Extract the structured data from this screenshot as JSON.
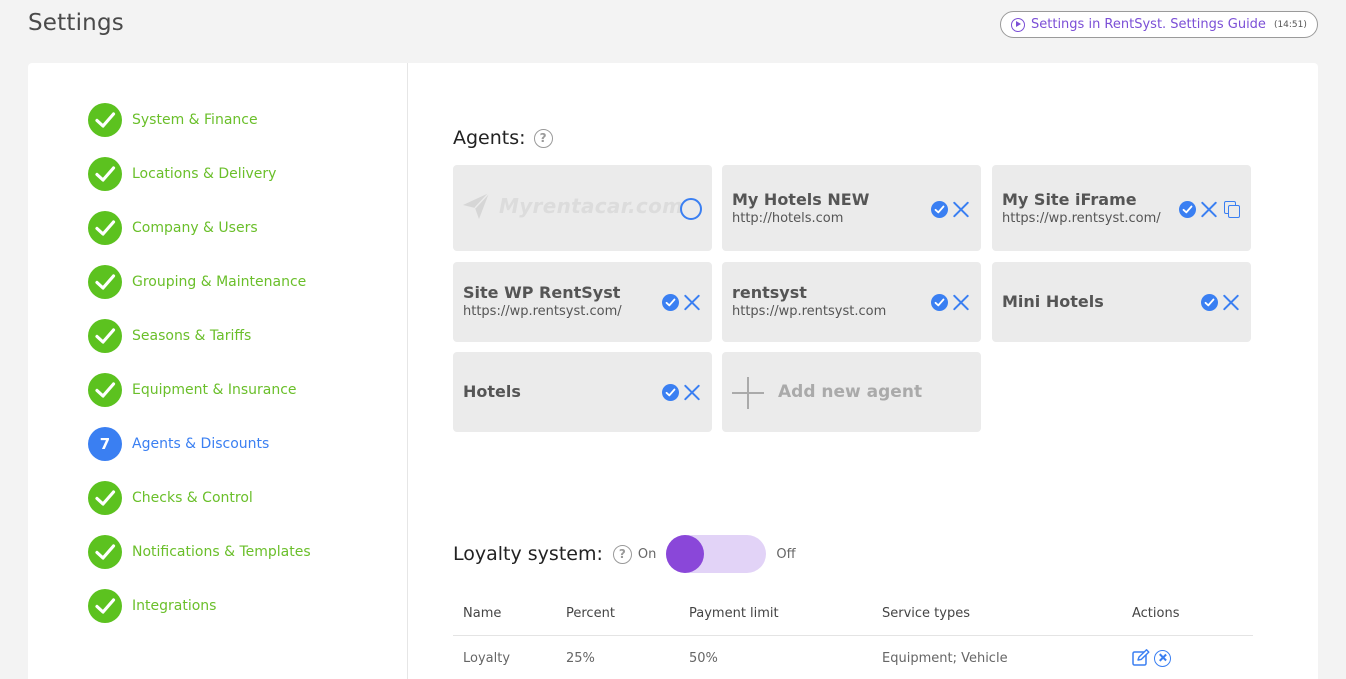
{
  "page": {
    "title": "Settings"
  },
  "guide": {
    "label": "Settings in RentSyst. Settings Guide",
    "duration": "(14:51)"
  },
  "colors": {
    "done": "#5cc21f",
    "active": "#3a7ff2",
    "toggle_knob": "#8a47d9",
    "toggle_track": "#e2d3f7"
  },
  "steps": [
    {
      "label": "System & Finance",
      "status": "done"
    },
    {
      "label": "Locations & Delivery",
      "status": "done"
    },
    {
      "label": "Company & Users",
      "status": "done"
    },
    {
      "label": "Grouping & Maintenance",
      "status": "done"
    },
    {
      "label": "Seasons & Tariffs",
      "status": "done"
    },
    {
      "label": "Equipment & Insurance",
      "status": "done"
    },
    {
      "label": "Agents & Discounts",
      "status": "active",
      "number": "7"
    },
    {
      "label": "Checks & Control",
      "status": "done"
    },
    {
      "label": "Notifications & Templates",
      "status": "done"
    },
    {
      "label": "Integrations",
      "status": "done"
    }
  ],
  "agents": {
    "title": "Agents:",
    "help_icon": "question-circle-icon",
    "cards": [
      {
        "logo_text": "Myrentacar.com",
        "icons": [
          "radio-empty-icon"
        ]
      },
      {
        "name": "My Hotels NEW",
        "url": "http://hotels.com",
        "icons": [
          "check-circle-icon",
          "close-icon"
        ]
      },
      {
        "name": "My Site iFrame",
        "url": "https://wp.rentsyst.com/",
        "icons": [
          "check-circle-icon",
          "close-icon",
          "copy-icon"
        ]
      },
      {
        "name": "Site WP RentSyst",
        "url": "https://wp.rentsyst.com/",
        "icons": [
          "check-circle-icon",
          "close-icon"
        ]
      },
      {
        "name": "rentsyst",
        "url": "https://wp.rentsyst.com",
        "icons": [
          "check-circle-icon",
          "close-icon"
        ]
      },
      {
        "name": "Mini Hotels",
        "icons": [
          "check-circle-icon",
          "close-icon"
        ]
      },
      {
        "name": "Hotels",
        "icons": [
          "check-circle-icon",
          "close-icon"
        ]
      }
    ],
    "add_label": "Add new agent"
  },
  "loyalty": {
    "title": "Loyalty system:",
    "on_label": "On",
    "off_label": "Off",
    "toggle_state": "on",
    "columns": [
      "Name",
      "Percent",
      "Payment limit",
      "Service types",
      "Actions"
    ],
    "rows": [
      {
        "name": "Loyalty",
        "percent": "25%",
        "payment_limit": "50%",
        "service_types": "Equipment; Vehicle",
        "actions": [
          "edit-icon",
          "remove-circle-icon"
        ]
      }
    ]
  }
}
